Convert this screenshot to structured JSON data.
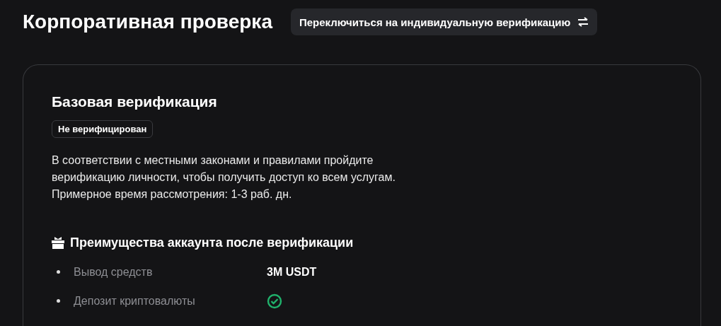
{
  "page": {
    "title": "Корпоративная проверка",
    "switch_button": "Переключиться на индивидуальную верификацию"
  },
  "card": {
    "title": "Базовая верификация",
    "status": "Не верифицирован",
    "description": "В соответствии с местными законами и правилами пройдите верификацию личности, чтобы получить доступ ко всем услугам. Примерное время рассмотрения: 1-3 раб. дн.",
    "benefits_title": "Преимущества аккаунта после верификации",
    "benefits": [
      {
        "label": "Вывод средств",
        "kind": "text",
        "value": "3M USDT"
      },
      {
        "label": "Депозит криптовалюты",
        "kind": "check"
      }
    ]
  }
}
